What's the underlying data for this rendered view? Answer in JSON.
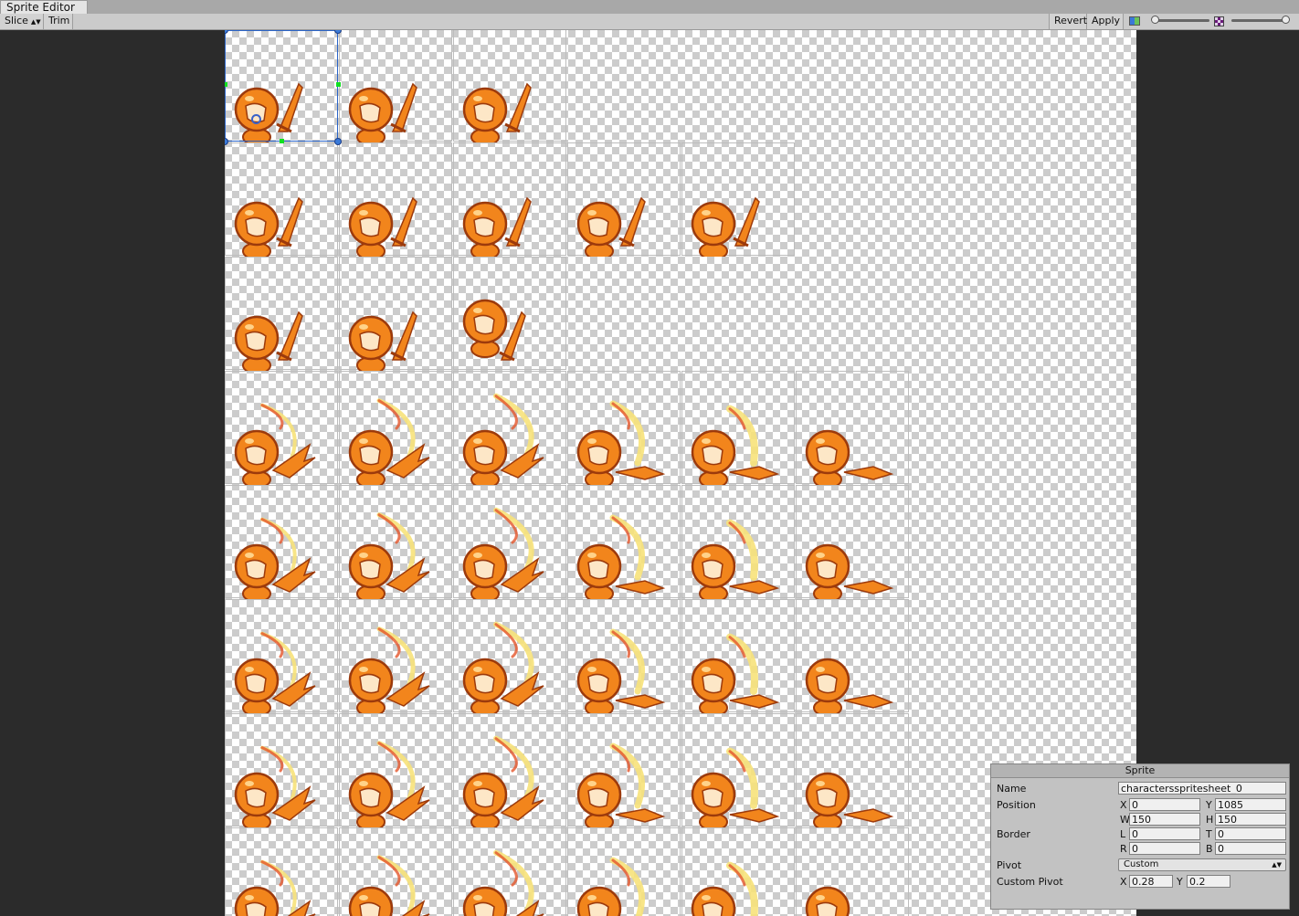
{
  "window": {
    "tab_title": "Sprite Editor"
  },
  "toolbar": {
    "slice_label": "Slice",
    "trim_label": "Trim",
    "revert_label": "Revert",
    "apply_label": "Apply"
  },
  "icons": {
    "color_toggle": "color-channel-icon",
    "alpha_toggle": "checker-alpha-icon"
  },
  "sheet": {
    "rows": [
      {
        "pose": "idle",
        "frames": 3
      },
      {
        "pose": "walk",
        "frames": 5
      },
      {
        "pose": "jump",
        "frames": 3
      },
      {
        "pose": "attack",
        "frames": 6
      },
      {
        "pose": "attack",
        "frames": 6
      },
      {
        "pose": "attack",
        "frames": 6
      },
      {
        "pose": "attack",
        "frames": 6
      },
      {
        "pose": "partial",
        "frames": 6
      }
    ],
    "colors": {
      "body": "#f2851c",
      "outline": "#9c3a0c",
      "face": "#fde7c7",
      "slash": "#f7e27a"
    }
  },
  "sprite_panel": {
    "title": "Sprite",
    "name_label": "Name",
    "name_value": "charactersspritesheet_0",
    "position_label": "Position",
    "x_label": "X",
    "x_value": "0",
    "y_label": "Y",
    "y_value": "1085",
    "w_label": "W",
    "w_value": "150",
    "h_label": "H",
    "h_value": "150",
    "border_label": "Border",
    "l_label": "L",
    "l_value": "0",
    "t_label": "T",
    "t_value": "0",
    "r_label": "R",
    "r_value": "0",
    "b_label": "B",
    "b_value": "0",
    "pivot_label": "Pivot",
    "pivot_value": "Custom",
    "custom_pivot_label": "Custom Pivot",
    "cpx_label": "X",
    "cpx_value": "0.28",
    "cpy_label": "Y",
    "cpy_value": "0.2"
  }
}
